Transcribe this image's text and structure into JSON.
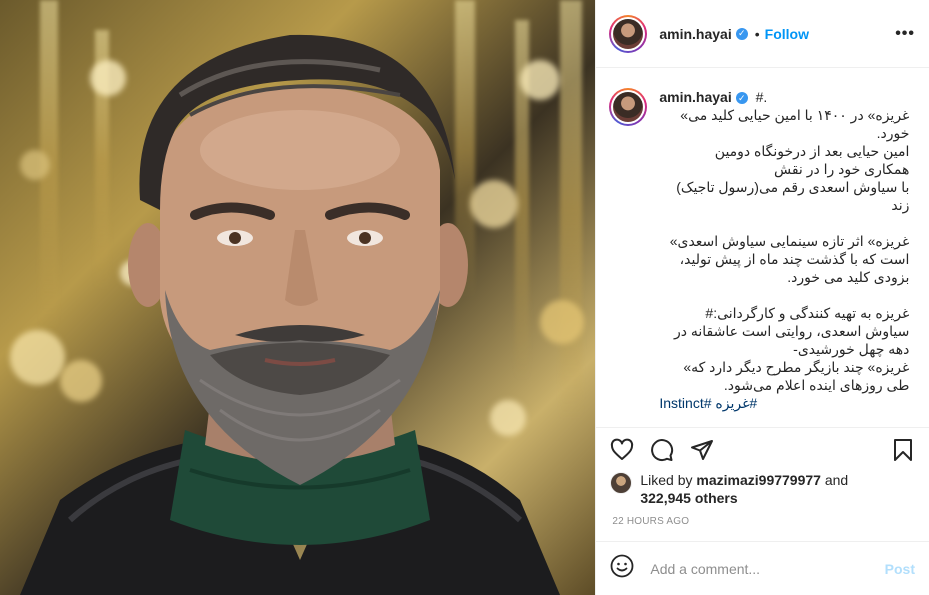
{
  "header": {
    "username": "amin.hayai",
    "separator": "•",
    "follow_label": "Follow",
    "more_icon": "more-options-icon"
  },
  "caption": {
    "username": "amin.hayai",
    "suffix": "#.",
    "lines": [
      "غریزه» در ۱۴۰۰ با امین حیایی کلید می»",
      "خورد.",
      "امین حیایی بعد از درخونگاه دومین",
      "همکاری خود را در نقش",
      "با سیاوش اسعدی رقم می(رسول تاجیک)",
      "زند",
      "غریزه» اثر تازه سینمایی سیاوش اسعدی»",
      "است که با گذشت چند ماه از پیش تولید،",
      "بزودی کلید می خورد.",
      "غریزه به تهیه کنندگی و کارگردانی:#",
      "سیاوش اسعدی، روایتی است عاشقانه در",
      "دهه چهل خورشیدی-",
      "غریزه» چند بازیگر مطرح دیگر دارد که»",
      "طی روزهای اینده اعلام می‌شود.",
      "#غریزه #Instinct"
    ]
  },
  "actions": {
    "like_icon": "heart-icon",
    "comment_icon": "comment-icon",
    "share_icon": "share-icon",
    "save_icon": "bookmark-icon"
  },
  "likes": {
    "prefix": "Liked by",
    "user": "mazimazi99779977",
    "and": "and",
    "count": "322,945 others"
  },
  "timestamp": "22 HOURS AGO",
  "add_comment": {
    "placeholder": "Add a comment...",
    "post_label": "Post",
    "emoji_icon": "emoji-icon"
  },
  "colors": {
    "link_blue": "#0095f6",
    "hashtag": "#00376b",
    "post_disabled": "#b2dffc",
    "muted": "#8e8e8e"
  }
}
